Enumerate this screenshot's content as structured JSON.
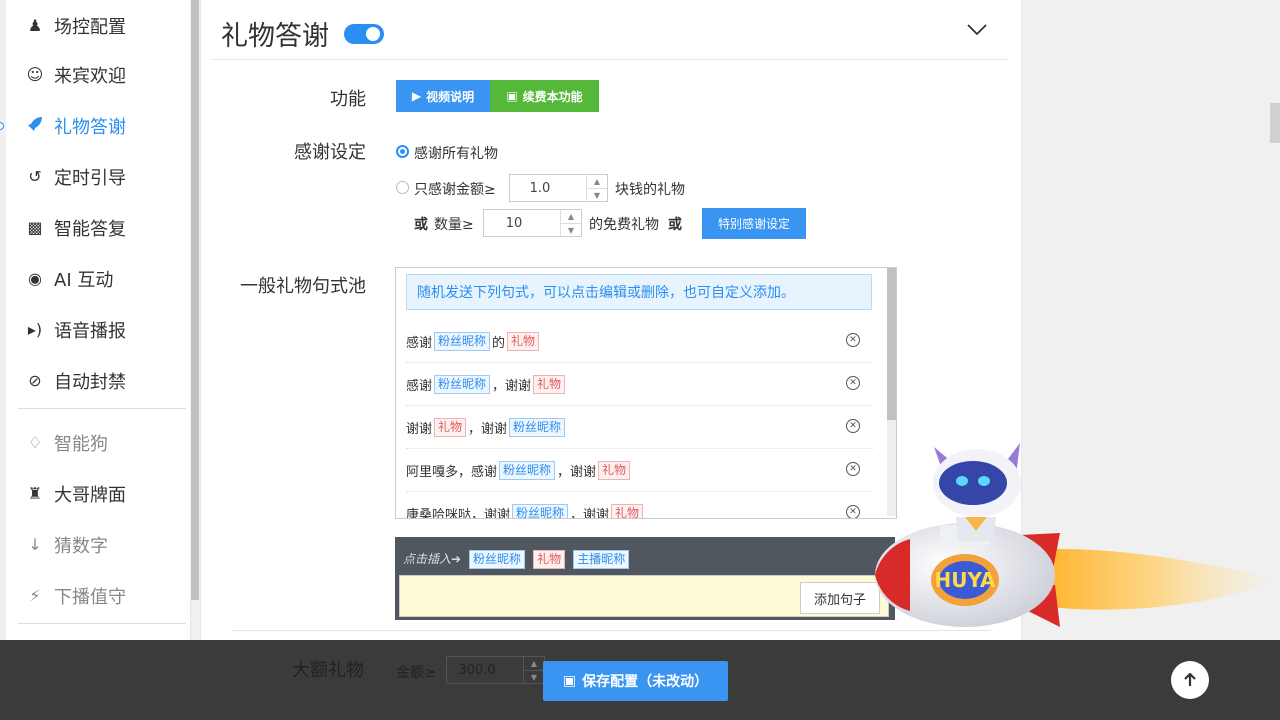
{
  "sidebar": {
    "items": [
      {
        "label": "场控配置",
        "icon": "user-icon"
      },
      {
        "label": "来宾欢迎",
        "icon": "smile-icon"
      },
      {
        "label": "礼物答谢",
        "icon": "rocket-icon"
      },
      {
        "label": "定时引导",
        "icon": "history-icon"
      },
      {
        "label": "智能答复",
        "icon": "comments-icon"
      },
      {
        "label": "AI 互动",
        "icon": "robot-icon"
      },
      {
        "label": "语音播报",
        "icon": "volume-icon"
      },
      {
        "label": "自动封禁",
        "icon": "ban-icon"
      },
      {
        "label": "智能狗",
        "icon": "diamond-icon"
      },
      {
        "label": "大哥牌面",
        "icon": "crown-icon"
      },
      {
        "label": "猜数字",
        "icon": "sort-numeric-icon"
      },
      {
        "label": "下播值守",
        "icon": "plug-icon"
      }
    ]
  },
  "header": {
    "title": "礼物答谢",
    "enabled": true
  },
  "function": {
    "label": "功能",
    "video_btn": "视频说明",
    "renew_btn": "续费本功能"
  },
  "thanks": {
    "label": "感谢设定",
    "opt_all": "感谢所有礼物",
    "opt_amount": "只感谢金额≥",
    "amount_value": "1.0",
    "amount_suffix": "块钱的礼物",
    "or": "或",
    "qty_label": "数量≥",
    "qty_value": "10",
    "qty_suffix": "的免费礼物",
    "or2": "或",
    "special_btn": "特别感谢设定"
  },
  "pool": {
    "label": "一般礼物句式池",
    "hint": "随机发送下列句式，可以点击编辑或删除，也可自定义添加。",
    "rows": [
      {
        "p1": "感谢",
        "t1": "粉丝昵称",
        "p2": "的",
        "t2": "礼物",
        "p3": "",
        "t3": ""
      },
      {
        "p1": "感谢",
        "t1": "粉丝昵称",
        "p2": "，谢谢",
        "t2": "礼物",
        "p3": "",
        "t3": ""
      },
      {
        "p1": "谢谢",
        "t1": "礼物",
        "p2": "，谢谢",
        "t2": "粉丝昵称",
        "p3": "",
        "t3": ""
      },
      {
        "p1": "阿里嘎多，感谢",
        "t1": "粉丝昵称",
        "p2": "，谢谢",
        "t2": "礼物",
        "p3": "",
        "t3": ""
      },
      {
        "p1": "康桑哈咪哒，谢谢",
        "t1": "粉丝昵称",
        "p2": "，谢谢",
        "t2": "礼物",
        "p3": "",
        "t3": ""
      }
    ]
  },
  "insert": {
    "label": "点击插入➜",
    "tag_fan": "粉丝昵称",
    "tag_gift": "礼物",
    "tag_host": "主播昵称",
    "add_btn": "添加句子"
  },
  "big_gift": {
    "label": "大额礼物",
    "amount_label": "金额≥",
    "amount_value": "300.0"
  },
  "footer": {
    "save_btn": "保存配置（未改动）"
  },
  "mascot": {
    "brand": "HUYA"
  }
}
